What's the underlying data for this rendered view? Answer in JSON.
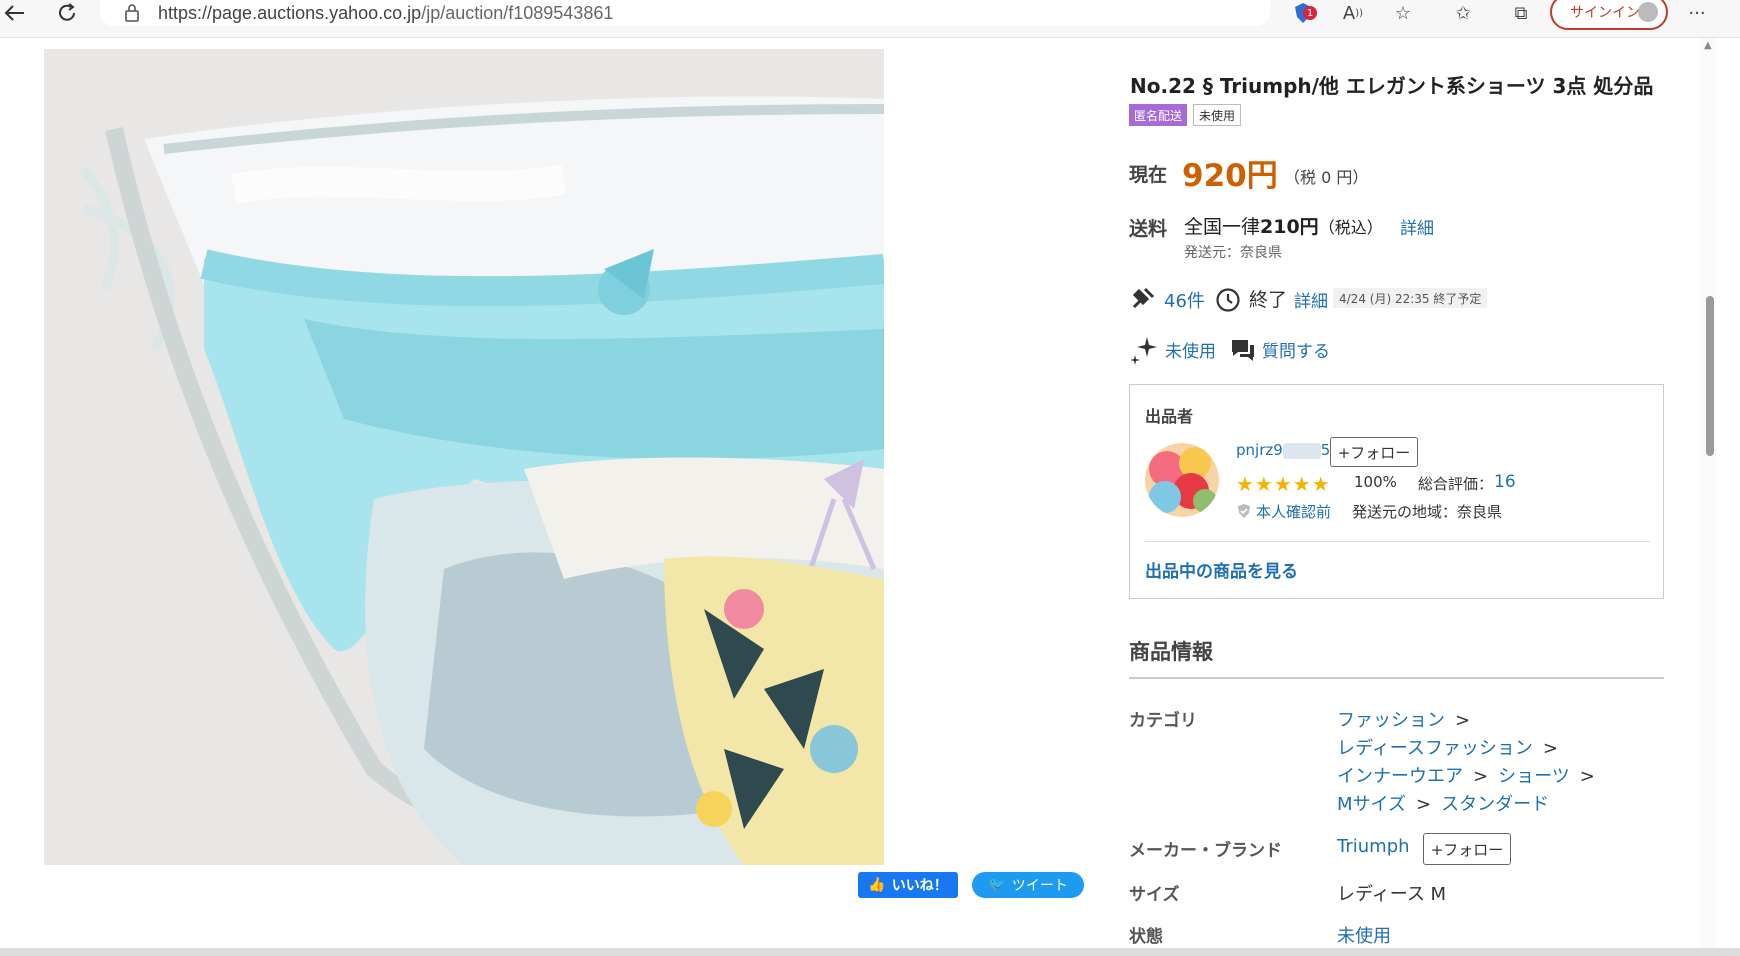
{
  "browser": {
    "url_host": "https://page.auctions.yahoo.co.jp",
    "url_path": "/jp/auction/f1089543861",
    "signin_label": "サインイン",
    "notification_count": "1"
  },
  "social": {
    "like_label": "いいね！",
    "tweet_label": "ツイート"
  },
  "product": {
    "title": "No.22 § Triumph/他 エレガント系ショーツ 3点 処分品",
    "tags": [
      "匿名配送",
      "未使用"
    ],
    "price_label": "現在",
    "price": "920円",
    "tax": "（税 0 円）",
    "shipping_label": "送料",
    "shipping_prefix": "全国一律",
    "shipping_amount": "210円",
    "shipping_suffix": "（税込）",
    "shipping_detail": "詳細",
    "ship_from": "発送元：奈良県",
    "bids": "46件",
    "status": "終了",
    "status_detail": "詳細",
    "end_date": "4/24 (月) 22:35 終了予定",
    "condition_link": "未使用",
    "ask_link": "質問する"
  },
  "seller": {
    "heading": "出品者",
    "name_prefix": "pnjrz9",
    "name_suffix": "5",
    "follow_label": "+フォロー",
    "stars": "★★★★★",
    "good_pct": "100%",
    "rating_label": "総合評価：",
    "rating": "16",
    "verify_label": "本人確認前",
    "region": "発送元の地域：奈良県",
    "items_link": "出品中の商品を見る"
  },
  "info": {
    "heading": "商品情報",
    "category_label": "カテゴリ",
    "categories": [
      "ファッション",
      "レディースファッション",
      "インナーウエア",
      "ショーツ",
      "Mサイズ",
      "スタンダード"
    ],
    "brand_label": "メーカー・ブランド",
    "brand": "Triumph",
    "brand_follow": "+フォロー",
    "size_label": "サイズ",
    "size": "レディース M",
    "condition_label": "状態",
    "condition": "未使用"
  },
  "colors": {
    "price": "#d05f00",
    "link": "#1f6fb2",
    "anon_tag": "#a66bd6",
    "signin_border": "#c0392b"
  }
}
